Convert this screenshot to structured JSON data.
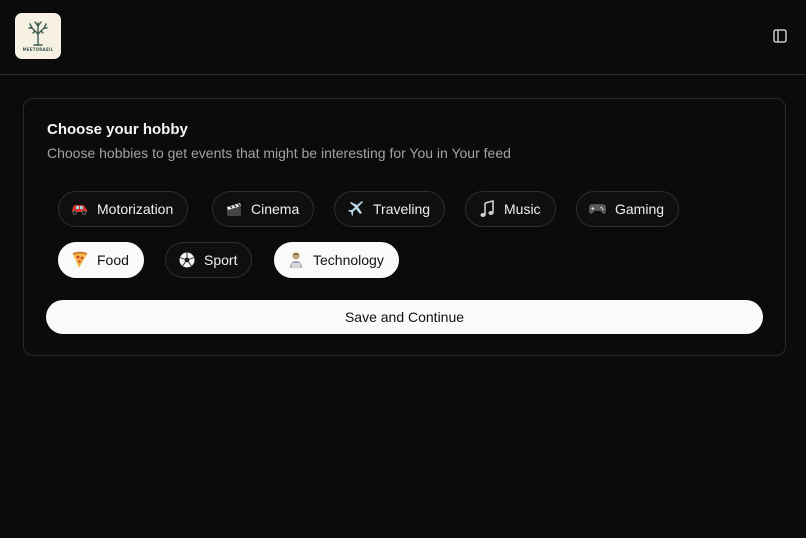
{
  "header": {
    "logo_text": "MEETORASIL"
  },
  "hobby": {
    "title": "Choose your hobby",
    "subtitle": "Choose hobbies to get events that might be interesting for You in Your feed",
    "chips": [
      {
        "label": "Motorization",
        "icon": "car-icon",
        "selected": false
      },
      {
        "label": "Cinema",
        "icon": "clapper-icon",
        "selected": false
      },
      {
        "label": "Traveling",
        "icon": "airplane-icon",
        "selected": false
      },
      {
        "label": "Music",
        "icon": "music-note-icon",
        "selected": false
      },
      {
        "label": "Gaming",
        "icon": "gamepad-icon",
        "selected": false
      },
      {
        "label": "Food",
        "icon": "pizza-icon",
        "selected": true
      },
      {
        "label": "Sport",
        "icon": "soccer-ball-icon",
        "selected": false
      },
      {
        "label": "Technology",
        "icon": "technologist-icon",
        "selected": true
      }
    ],
    "save_label": "Save and Continue"
  }
}
